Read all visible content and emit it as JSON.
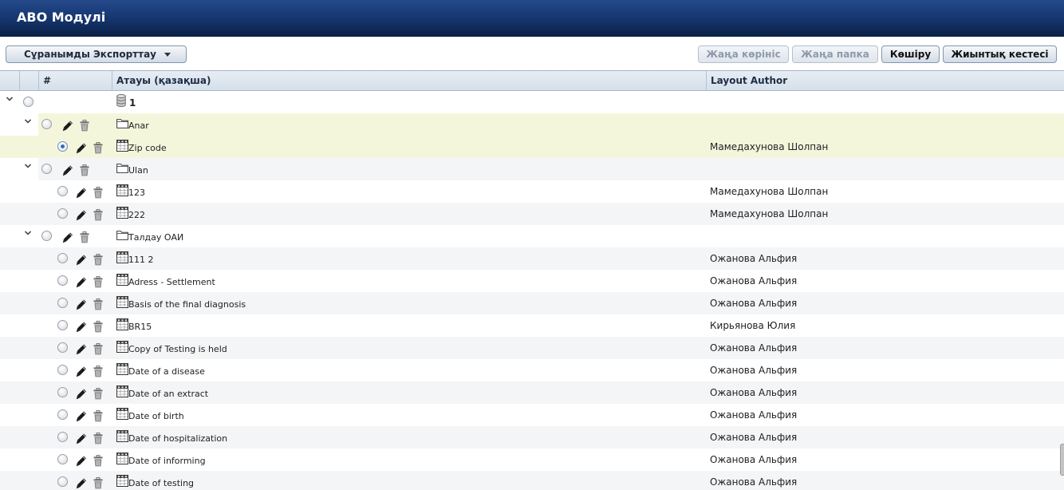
{
  "app": {
    "title": "АВО Модулі"
  },
  "theme": {
    "header_bar": "#163670",
    "grid_header": "#d6e0ea",
    "highlight_row": "#f4f6dc",
    "alt_row": "#f4f5f7",
    "selected_radio": "#3b6cb6"
  },
  "toolbar": {
    "export": {
      "label": "Сұранымды Экспорттау",
      "icon": "caret-down-icon"
    },
    "actions": [
      {
        "label": "Жаңа көрініс",
        "disabled": true
      },
      {
        "label": "Жаңа папка",
        "disabled": true
      },
      {
        "label": "Көшіру",
        "disabled": false
      },
      {
        "label": "Жиынтық кестесі",
        "disabled": false
      }
    ]
  },
  "table": {
    "columns": {
      "index": "#",
      "name": "Атауы (қазақша)",
      "author": "Layout Author"
    },
    "rows": [
      {
        "depth": 0,
        "icon": "database-icon",
        "name": "1",
        "expanded": true
      },
      {
        "depth": 1,
        "icon": "folder-icon",
        "name": "Anar",
        "expanded": true,
        "highlighted": true
      },
      {
        "depth": 2,
        "icon": "table-icon",
        "name": "Zip code",
        "author": "Мамедахунова Шолпан",
        "selected": true,
        "highlighted": true
      },
      {
        "depth": 1,
        "icon": "folder-icon",
        "name": "Ulan",
        "expanded": true
      },
      {
        "depth": 2,
        "icon": "table-icon",
        "name": "123",
        "author": "Мамедахунова Шолпан"
      },
      {
        "depth": 2,
        "icon": "table-icon",
        "name": "222",
        "author": "Мамедахунова Шолпан"
      },
      {
        "depth": 1,
        "icon": "folder-icon",
        "name": "Талдау ОАИ",
        "expanded": true
      },
      {
        "depth": 2,
        "icon": "table-icon",
        "name": "111 2",
        "author": "Ожанова Альфия"
      },
      {
        "depth": 2,
        "icon": "table-icon",
        "name": "Adress - Settlement",
        "author": "Ожанова Альфия"
      },
      {
        "depth": 2,
        "icon": "table-icon",
        "name": "Basis of the final diagnosis",
        "author": "Ожанова Альфия"
      },
      {
        "depth": 2,
        "icon": "table-icon",
        "name": "BR15",
        "author": "Кирьянова Юлия"
      },
      {
        "depth": 2,
        "icon": "table-icon",
        "name": "Copy of Testing is held",
        "author": "Ожанова Альфия"
      },
      {
        "depth": 2,
        "icon": "table-icon",
        "name": "Date of a disease",
        "author": "Ожанова Альфия"
      },
      {
        "depth": 2,
        "icon": "table-icon",
        "name": "Date of an extract",
        "author": "Ожанова Альфия"
      },
      {
        "depth": 2,
        "icon": "table-icon",
        "name": "Date of birth",
        "author": "Ожанова Альфия"
      },
      {
        "depth": 2,
        "icon": "table-icon",
        "name": "Date of hospitalization",
        "author": "Ожанова Альфия"
      },
      {
        "depth": 2,
        "icon": "table-icon",
        "name": "Date of informing",
        "author": "Ожанова Альфия"
      },
      {
        "depth": 2,
        "icon": "table-icon",
        "name": "Date of testing",
        "author": "Ожанова Альфия"
      }
    ]
  }
}
